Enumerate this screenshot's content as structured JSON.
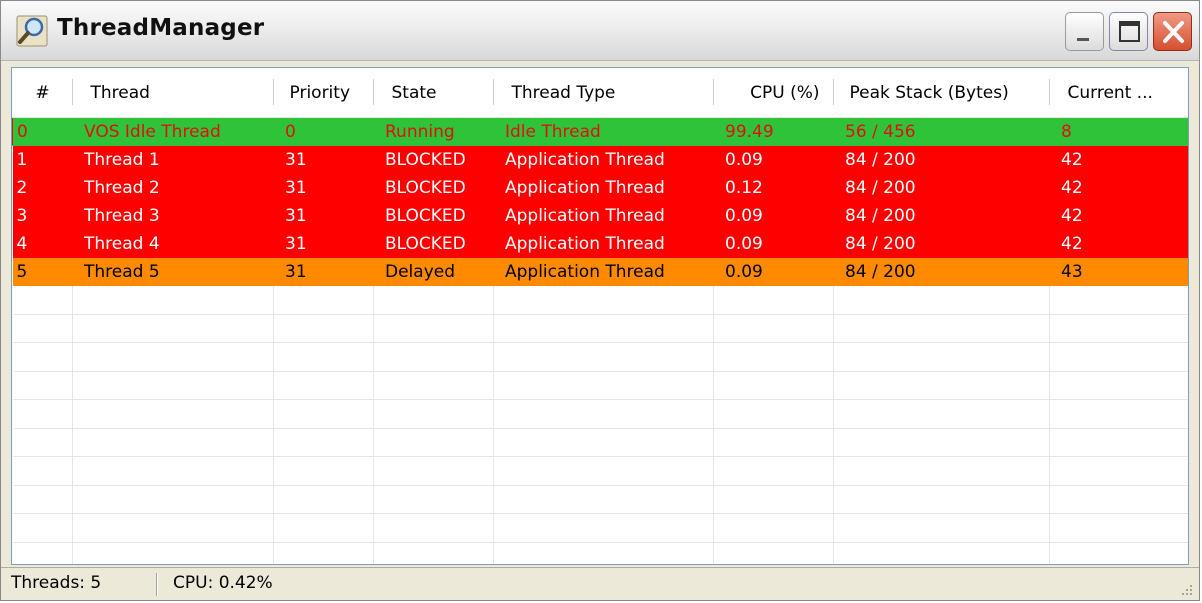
{
  "window": {
    "title": "ThreadManager"
  },
  "columns": [
    "#",
    "Thread",
    "Priority",
    "State",
    "Thread Type",
    "CPU (%)",
    "Peak Stack (Bytes)",
    "Current ..."
  ],
  "rows": [
    {
      "num": "0",
      "thread": "VOS Idle Thread",
      "priority": "0",
      "state": "Running",
      "type": "Idle Thread",
      "cpu": "99.49",
      "peak": "56 / 456",
      "current": "8",
      "row_class": "state-running"
    },
    {
      "num": "1",
      "thread": "Thread 1",
      "priority": "31",
      "state": "BLOCKED",
      "type": "Application Thread",
      "cpu": "0.09",
      "peak": "84 / 200",
      "current": "42",
      "row_class": "state-blocked"
    },
    {
      "num": "2",
      "thread": "Thread 2",
      "priority": "31",
      "state": "BLOCKED",
      "type": "Application Thread",
      "cpu": "0.12",
      "peak": "84 / 200",
      "current": "42",
      "row_class": "state-blocked"
    },
    {
      "num": "3",
      "thread": "Thread 3",
      "priority": "31",
      "state": "BLOCKED",
      "type": "Application Thread",
      "cpu": "0.09",
      "peak": "84 / 200",
      "current": "42",
      "row_class": "state-blocked"
    },
    {
      "num": "4",
      "thread": "Thread 4",
      "priority": "31",
      "state": "BLOCKED",
      "type": "Application Thread",
      "cpu": "0.09",
      "peak": "84 / 200",
      "current": "42",
      "row_class": "state-blocked"
    },
    {
      "num": "5",
      "thread": "Thread 5",
      "priority": "31",
      "state": "Delayed",
      "type": "Application Thread",
      "cpu": "0.09",
      "peak": "84 / 200",
      "current": "43",
      "row_class": "state-delayed"
    }
  ],
  "statusbar": {
    "threads": "Threads: 5",
    "cpu": "CPU: 0.42%"
  },
  "colors": {
    "running": "#2fc33a",
    "blocked": "#fe0000",
    "delayed": "#ff8a00"
  },
  "icons": {
    "app": "magnifier-icon",
    "minimize": "minimize-icon",
    "maximize": "maximize-icon",
    "close": "close-icon",
    "grip": "resize-grip-icon"
  }
}
